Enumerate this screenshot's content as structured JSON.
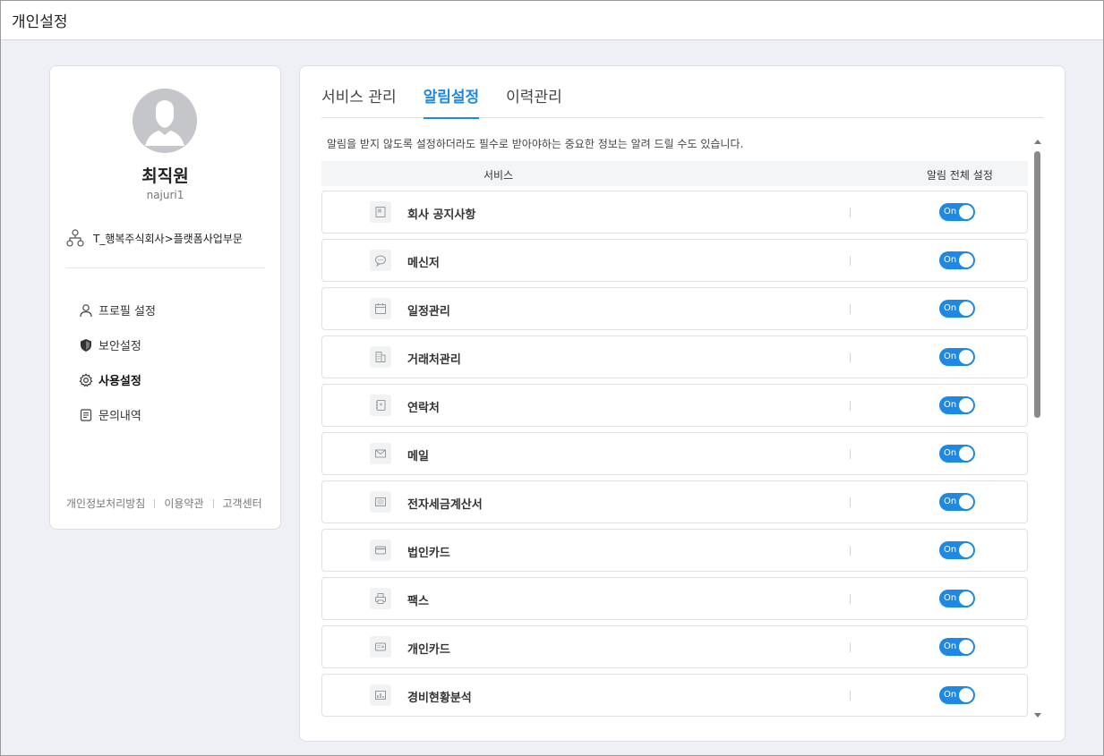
{
  "window": {
    "title": "개인설정"
  },
  "profile": {
    "name": "최직원",
    "user_id": "najuri1",
    "org": "T_행복주식회사>플랫폼사업부문"
  },
  "menu": [
    {
      "label": "프로필 설정",
      "icon": "person-icon",
      "active": false
    },
    {
      "label": "보안설정",
      "icon": "shield-icon",
      "active": false
    },
    {
      "label": "사용설정",
      "icon": "gear-icon",
      "active": true
    },
    {
      "label": "문의내역",
      "icon": "document-icon",
      "active": false
    }
  ],
  "footer": {
    "privacy": "개인정보처리방침",
    "terms": "이용약관",
    "support": "고객센터"
  },
  "tabs": [
    {
      "label": "서비스 관리",
      "active": false
    },
    {
      "label": "알림설정",
      "active": true
    },
    {
      "label": "이력관리",
      "active": false
    }
  ],
  "notice": "알림을 받지 않도록 설정하더라도 필수로 받아야하는 중요한 정보는 알려 드릴 수도 있습니다.",
  "table": {
    "col_service": "서비스",
    "col_all": "알림 전체 설정",
    "rows": [
      {
        "label": "회사 공지사항",
        "icon": "notice-icon",
        "toggle": "On"
      },
      {
        "label": "메신저",
        "icon": "chat-bubble-icon",
        "toggle": "On"
      },
      {
        "label": "일정관리",
        "icon": "calendar-icon",
        "toggle": "On"
      },
      {
        "label": "거래처관리",
        "icon": "building-icon",
        "toggle": "On"
      },
      {
        "label": "연락처",
        "icon": "address-book-icon",
        "toggle": "On"
      },
      {
        "label": "메일",
        "icon": "mail-icon",
        "toggle": "On"
      },
      {
        "label": "전자세금계산서",
        "icon": "invoice-icon",
        "toggle": "On"
      },
      {
        "label": "법인카드",
        "icon": "credit-card-icon",
        "toggle": "On"
      },
      {
        "label": "팩스",
        "icon": "fax-icon",
        "toggle": "On"
      },
      {
        "label": "개인카드",
        "icon": "id-card-icon",
        "toggle": "On"
      },
      {
        "label": "경비현황분석",
        "icon": "chart-icon",
        "toggle": "On"
      }
    ]
  },
  "colors": {
    "accent": "#1e88e5",
    "background": "#eef0f5"
  }
}
